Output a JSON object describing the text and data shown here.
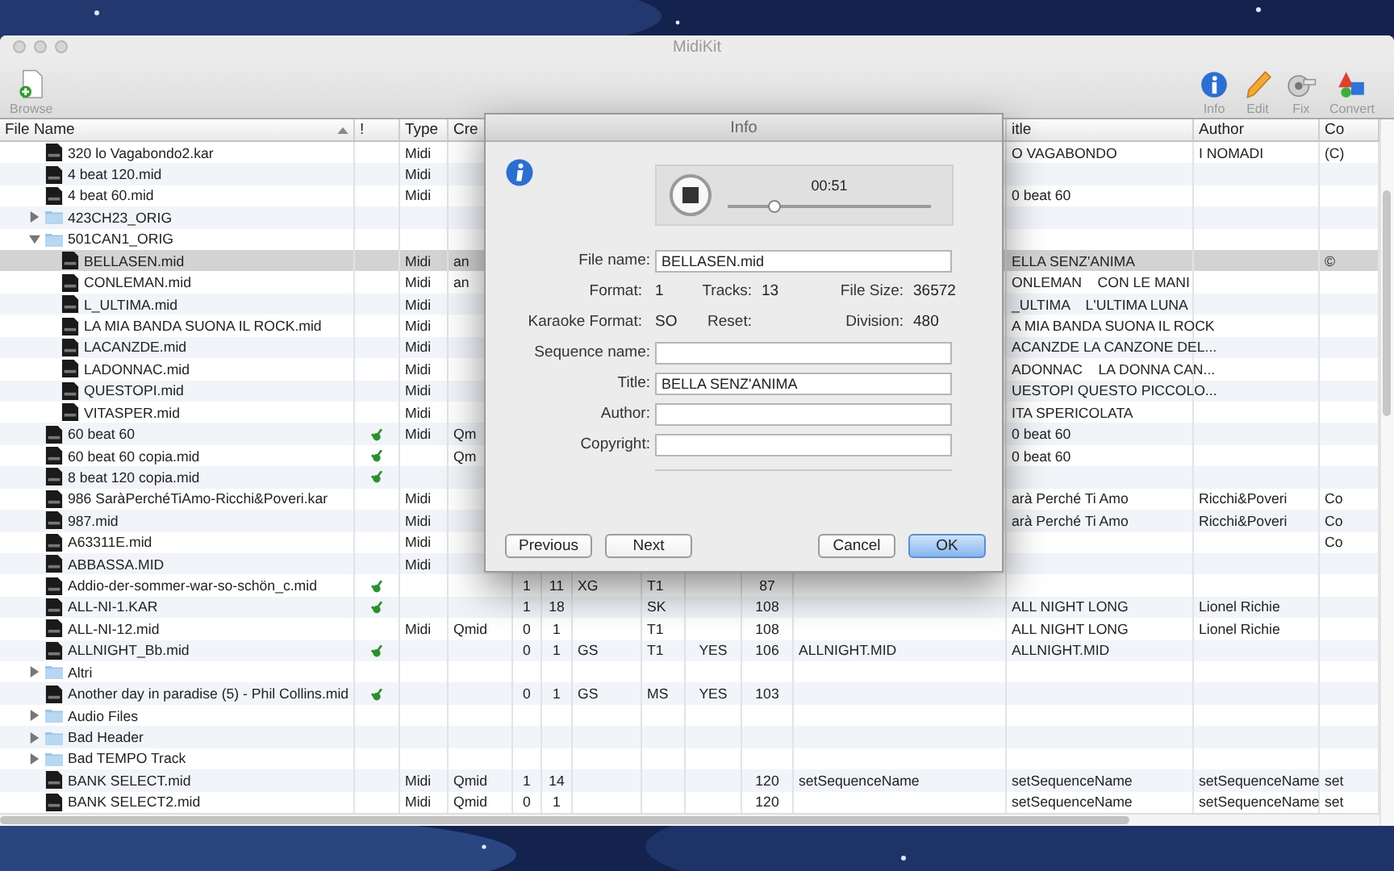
{
  "window": {
    "title": "MidiKit"
  },
  "toolbar": {
    "left": [
      {
        "kind": "browse",
        "label": "Browse"
      }
    ],
    "right": [
      {
        "kind": "info",
        "label": "Info"
      },
      {
        "kind": "edit",
        "label": "Edit"
      },
      {
        "kind": "fix",
        "label": "Fix"
      },
      {
        "kind": "convert",
        "label": "Convert"
      }
    ]
  },
  "table": {
    "columns": [
      "File Name",
      "!",
      "Type",
      "Cre",
      null,
      null,
      null,
      null,
      null,
      null,
      null,
      "itle",
      "Author",
      "Co"
    ],
    "rows": [
      {
        "name": "320 lo Vagabondo2.kar",
        "kind": "file",
        "selected": false,
        "check": false,
        "cells": [
          "Midi",
          null,
          null,
          null,
          null,
          null,
          null,
          null,
          null,
          "O VAGABONDO",
          "I NOMADI",
          "(C)"
        ]
      },
      {
        "name": "4 beat 120.mid",
        "kind": "file",
        "selected": false,
        "check": false,
        "cells": [
          "Midi"
        ]
      },
      {
        "name": "4 beat 60.mid",
        "kind": "file",
        "selected": false,
        "check": false,
        "cells": [
          "Midi",
          null,
          null,
          null,
          null,
          null,
          null,
          null,
          null,
          "0 beat 60"
        ]
      },
      {
        "name": "423CH23_ORIG",
        "kind": "folder",
        "selected": false,
        "expanded": false
      },
      {
        "name": "501CAN1_ORIG",
        "kind": "folder",
        "selected": false,
        "expanded": true,
        "children": [
          {
            "name": "BELLASEN.mid",
            "kind": "file",
            "selected": true,
            "check": false,
            "cells": [
              "Midi",
              "an",
              null,
              null,
              null,
              null,
              null,
              null,
              null,
              "ELLA SENZ'ANIMA",
              null,
              "©"
            ]
          },
          {
            "name": "CONLEMAN.mid",
            "kind": "file",
            "selected": false,
            "check": false,
            "cells": [
              "Midi",
              "an",
              null,
              null,
              null,
              null,
              null,
              null,
              null,
              "ONLEMAN    CON LE MANI"
            ]
          },
          {
            "name": "L_ULTIMA.mid",
            "kind": "file",
            "selected": false,
            "check": false,
            "cells": [
              "Midi",
              null,
              null,
              null,
              null,
              null,
              null,
              null,
              null,
              "_ULTIMA    L'ULTIMA LUNA"
            ]
          },
          {
            "name": "LA MIA BANDA SUONA IL ROCK.mid",
            "kind": "file",
            "selected": false,
            "check": false,
            "cells": [
              "Midi",
              null,
              null,
              null,
              null,
              null,
              null,
              null,
              null,
              "A MIA BANDA SUONA IL ROCK"
            ]
          },
          {
            "name": "LACANZDE.mid",
            "kind": "file",
            "selected": false,
            "check": false,
            "cells": [
              "Midi",
              null,
              null,
              null,
              null,
              null,
              null,
              null,
              null,
              "ACANZDE LA CANZONE DEL..."
            ]
          },
          {
            "name": "LADONNAC.mid",
            "kind": "file",
            "selected": false,
            "check": false,
            "cells": [
              "Midi",
              null,
              null,
              null,
              null,
              null,
              null,
              null,
              null,
              "ADONNAC    LA DONNA CAN..."
            ]
          },
          {
            "name": "QUESTOPI.mid",
            "kind": "file",
            "selected": false,
            "check": false,
            "cells": [
              "Midi",
              null,
              null,
              null,
              null,
              null,
              null,
              null,
              null,
              "UESTOPI QUESTO PICCOLO..."
            ]
          },
          {
            "name": "VITASPER.mid",
            "kind": "file",
            "selected": false,
            "check": false,
            "cells": [
              "Midi",
              null,
              null,
              null,
              null,
              null,
              null,
              null,
              null,
              "ITA SPERICOLATA"
            ]
          }
        ]
      },
      {
        "name": "60 beat 60",
        "kind": "file",
        "selected": false,
        "check": true,
        "cells": [
          "Midi",
          "Qm",
          null,
          null,
          null,
          null,
          null,
          null,
          null,
          "0 beat 60"
        ]
      },
      {
        "name": "60 beat 60 copia.mid",
        "kind": "file",
        "selected": false,
        "check": true,
        "cells": [
          null,
          "Qm",
          null,
          null,
          null,
          null,
          null,
          null,
          null,
          "0 beat 60"
        ]
      },
      {
        "name": "8 beat 120 copia.mid",
        "kind": "file",
        "selected": false,
        "check": true
      },
      {
        "name": "986 SaràPerchéTiAmo-Ricchi&Poveri.kar",
        "kind": "file",
        "selected": false,
        "check": false,
        "cells": [
          "Midi",
          null,
          null,
          null,
          null,
          null,
          null,
          null,
          null,
          "arà Perché Ti Amo",
          "Ricchi&Poveri",
          "Co"
        ]
      },
      {
        "name": "987.mid",
        "kind": "file",
        "selected": false,
        "check": false,
        "cells": [
          "Midi",
          null,
          null,
          null,
          null,
          null,
          null,
          null,
          null,
          "arà Perché Ti Amo",
          "Ricchi&Poveri",
          "Co"
        ]
      },
      {
        "name": "A63311E.mid",
        "kind": "file",
        "selected": false,
        "check": false,
        "cells": [
          "Midi",
          null,
          null,
          null,
          null,
          null,
          null,
          null,
          null,
          null,
          null,
          "Co"
        ]
      },
      {
        "name": "ABBASSA.MID",
        "kind": "file",
        "selected": false,
        "check": false,
        "cells": [
          "Midi"
        ]
      },
      {
        "name": "Addio-der-sommer-war-so-schön_c.mid",
        "kind": "file",
        "selected": false,
        "check": true,
        "cells": [
          null,
          null,
          "1",
          "11",
          "XG",
          "T1",
          null,
          "87"
        ]
      },
      {
        "name": "ALL-NI-1.KAR",
        "kind": "file",
        "selected": false,
        "check": true,
        "cells": [
          null,
          null,
          "1",
          "18",
          null,
          "SK",
          null,
          "108",
          null,
          "ALL NIGHT LONG",
          "Lionel Richie"
        ]
      },
      {
        "name": "ALL-NI-12.mid",
        "kind": "file",
        "selected": false,
        "check": false,
        "cells": [
          "Midi",
          "Qmid",
          "0",
          "1",
          null,
          "T1",
          null,
          "108",
          null,
          "ALL NIGHT LONG",
          "Lionel Richie"
        ]
      },
      {
        "name": "ALLNIGHT_Bb.mid",
        "kind": "file",
        "selected": false,
        "check": true,
        "cells": [
          null,
          null,
          "0",
          "1",
          "GS",
          "T1",
          "YES",
          "106",
          "ALLNIGHT.MID",
          "ALLNIGHT.MID"
        ]
      },
      {
        "name": "Altri",
        "kind": "folder",
        "selected": false,
        "expanded": false
      },
      {
        "name": "Another day in paradise (5) - Phil Collins.mid",
        "kind": "file",
        "selected": false,
        "check": true,
        "cells": [
          null,
          null,
          "0",
          "1",
          "GS",
          "MS",
          "YES",
          "103"
        ]
      },
      {
        "name": "Audio Files",
        "kind": "folder",
        "selected": false,
        "expanded": false
      },
      {
        "name": "Bad Header",
        "kind": "folder",
        "selected": false,
        "expanded": false
      },
      {
        "name": "Bad TEMPO Track",
        "kind": "folder",
        "selected": false,
        "expanded": false
      },
      {
        "name": "BANK SELECT.mid",
        "kind": "file",
        "selected": false,
        "check": false,
        "cells": [
          "Midi",
          "Qmid",
          "1",
          "14",
          null,
          null,
          null,
          "120",
          "setSequenceName",
          "setSequenceName",
          "setSequenceName",
          "set"
        ]
      },
      {
        "name": "BANK SELECT2.mid",
        "kind": "file",
        "selected": false,
        "check": false,
        "cells": [
          "Midi",
          "Qmid",
          "0",
          "1",
          null,
          null,
          null,
          "120",
          null,
          "setSequenceName",
          "setSequenceName",
          "set"
        ]
      }
    ]
  },
  "dialog": {
    "title": "Info",
    "player": {
      "time": "00:51",
      "level": 0.23
    },
    "rows": [
      {
        "kind": "field",
        "label": "File name:",
        "value": "BELLASEN.mid"
      },
      {
        "kind": "info",
        "items": [
          {
            "label": "Format:",
            "value": "1"
          },
          {
            "label": "Tracks:",
            "value": "13"
          },
          {
            "label": "File Size:",
            "value": "36572"
          }
        ]
      },
      {
        "kind": "info",
        "items": [
          {
            "label": "Karaoke Format:",
            "value": "SO"
          },
          {
            "label": "Reset:"
          },
          {
            "label": "Division:",
            "value": "480"
          }
        ]
      },
      {
        "kind": "field",
        "label": "Sequence name:"
      },
      {
        "kind": "field",
        "label": "Title:",
        "value": "BELLA SENZ'ANIMA"
      },
      {
        "kind": "field",
        "label": "Author:"
      },
      {
        "kind": "field",
        "label": "Copyright:"
      }
    ],
    "buttons": [
      {
        "label": "Previous",
        "default": false
      },
      {
        "label": "Next",
        "default": false
      },
      {
        "label": "Cancel",
        "default": false
      },
      {
        "label": "OK",
        "default": true
      }
    ]
  }
}
